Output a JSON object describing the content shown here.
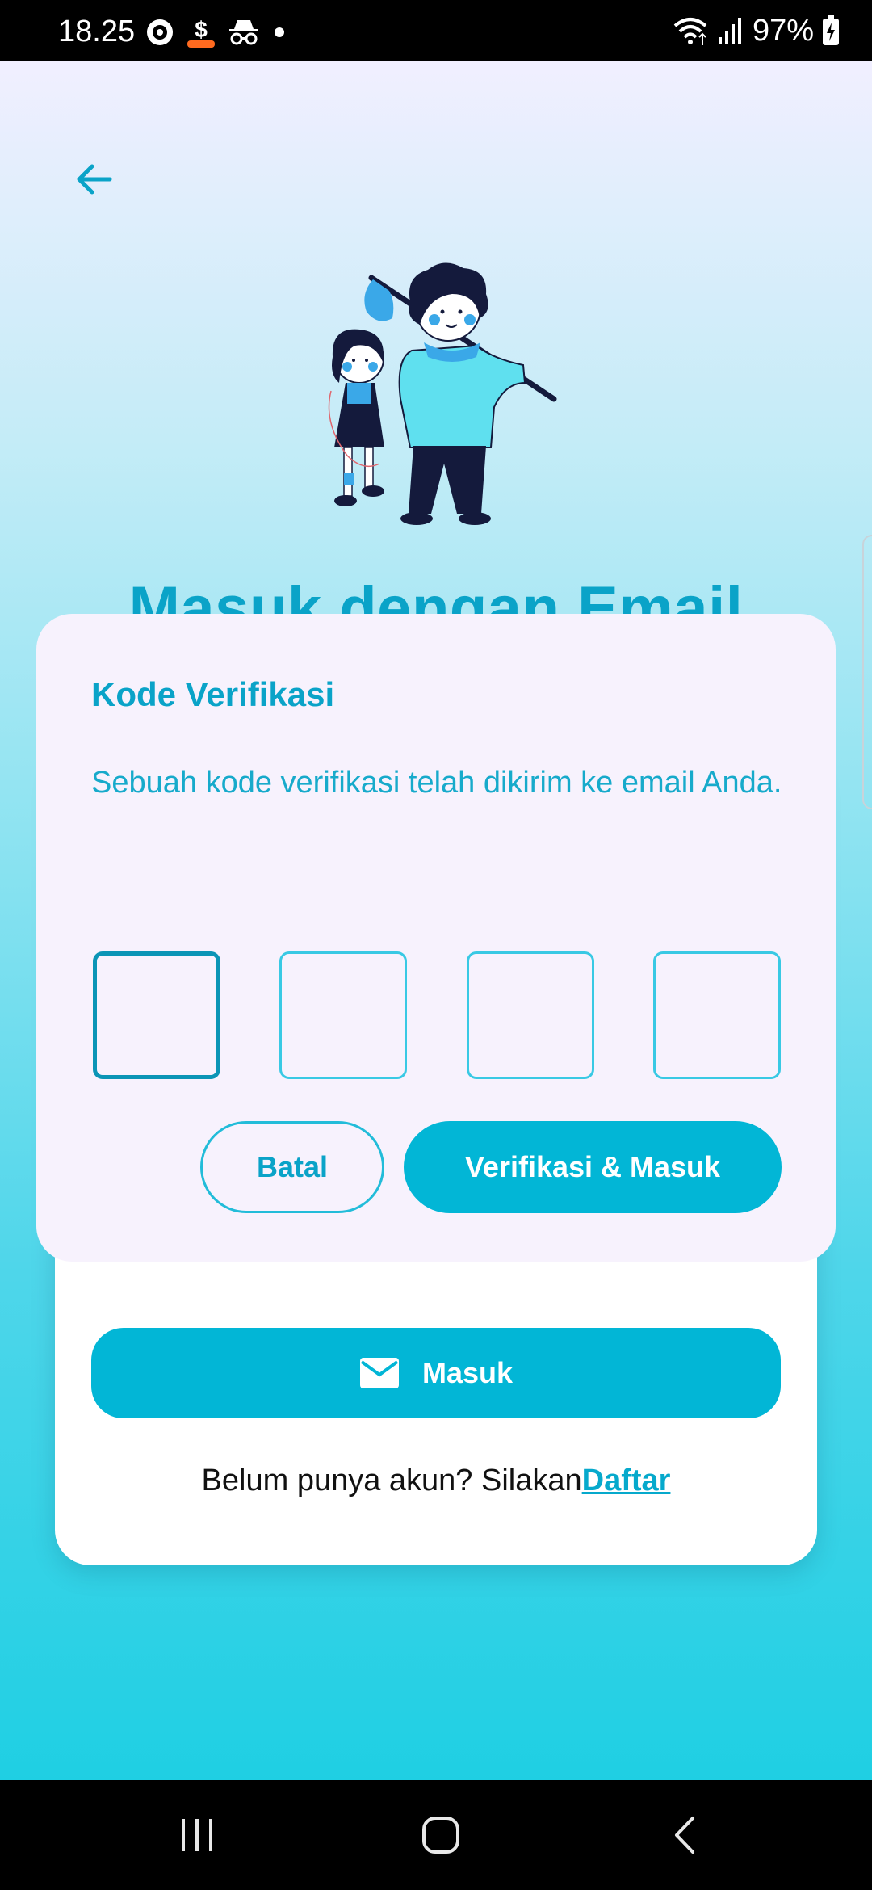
{
  "status_bar": {
    "time": "18.25",
    "battery_percent": "97%",
    "icons_left": [
      "target-icon",
      "dollar-badge-icon",
      "incognito-icon",
      "dot-icon"
    ],
    "icons_right": [
      "wifi-icon",
      "signal-icon",
      "battery-charging-icon"
    ]
  },
  "screen": {
    "page_title": "Masuk dengan Email",
    "login_button_label": "Masuk",
    "register_prompt": "Belum punya akun? Silakan",
    "register_link": "Daftar"
  },
  "dialog": {
    "title": "Kode Verifikasi",
    "message": "Sebuah kode verifikasi telah dikirim ke email Anda.",
    "code_values": [
      "",
      "",
      "",
      ""
    ],
    "cancel_label": "Batal",
    "verify_label": "Verifikasi & Masuk"
  },
  "colors": {
    "accent": "#02b6d6",
    "title": "#0aa3c8",
    "dialog_bg": "#f7f2fd",
    "navy": "#141a3c"
  },
  "nav_bar": {
    "buttons": [
      "recents-icon",
      "home-icon",
      "back-nav-icon"
    ]
  }
}
